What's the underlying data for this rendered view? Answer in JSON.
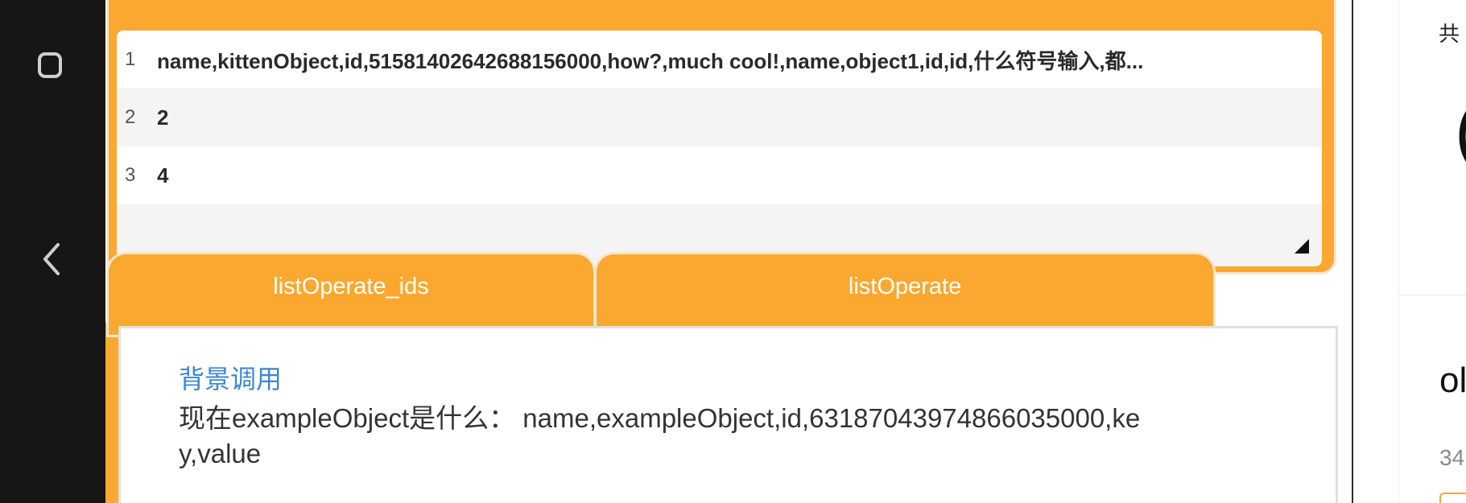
{
  "system_nav": {
    "recents_icon": "square-icon",
    "back_icon": "chevron-left-icon"
  },
  "text_area": {
    "lines": [
      {
        "num": "1",
        "text": "name,kittenObject,id,51581402642688156000,how?,much cool!,name,object1,id,id,什么符号输入,都..."
      },
      {
        "num": "2",
        "text": "2"
      },
      {
        "num": "3",
        "text": "4"
      }
    ]
  },
  "tabs": [
    {
      "label": "listOperate_ids"
    },
    {
      "label": "listOperate"
    }
  ],
  "card": {
    "title": "背景调用",
    "body": "现在exampleObject是什么： name,exampleObject,id,63187043974866035000,key,value"
  },
  "right_panel": {
    "top_char": "共",
    "paren": "(",
    "heading": "ol",
    "count": "34"
  },
  "colors": {
    "accent": "#fba830",
    "link": "#3d86cf",
    "sysbar": "#161616"
  }
}
